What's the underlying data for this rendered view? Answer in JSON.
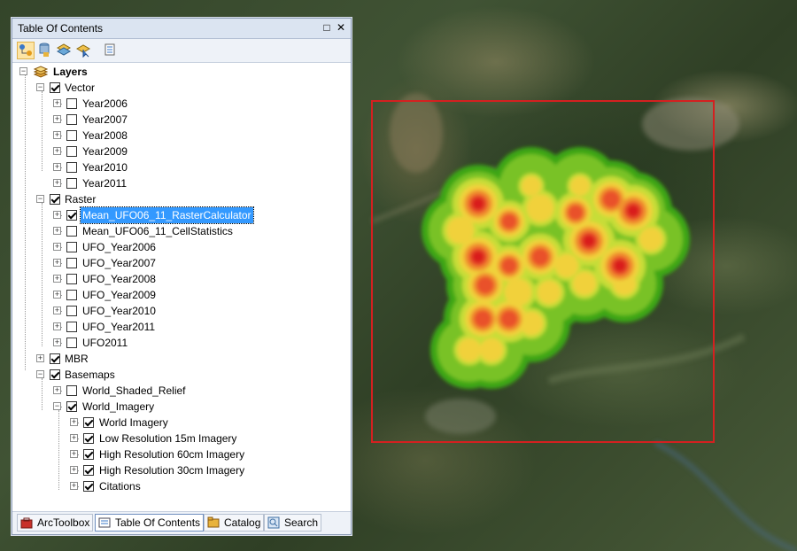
{
  "panel": {
    "title": "Table Of Contents",
    "controls": {
      "pin": "□",
      "close": "✕"
    }
  },
  "toolbar": {
    "buttons": [
      "list-by-drawing-order-icon",
      "list-by-source-icon",
      "list-by-visibility-icon",
      "list-by-selection-icon",
      "options-icon"
    ]
  },
  "tree": {
    "root": "Layers",
    "groups": {
      "vector": {
        "label": "Vector",
        "checked": true,
        "items": [
          {
            "label": "Year2006",
            "checked": false
          },
          {
            "label": "Year2007",
            "checked": false
          },
          {
            "label": "Year2008",
            "checked": false
          },
          {
            "label": "Year2009",
            "checked": false
          },
          {
            "label": "Year2010",
            "checked": false
          },
          {
            "label": "Year2011",
            "checked": false
          }
        ]
      },
      "raster": {
        "label": "Raster",
        "checked": true,
        "items": [
          {
            "label": "Mean_UFO06_11_RasterCalculator",
            "checked": true,
            "selected": true
          },
          {
            "label": "Mean_UFO06_11_CellStatistics",
            "checked": false
          },
          {
            "label": "UFO_Year2006",
            "checked": false
          },
          {
            "label": "UFO_Year2007",
            "checked": false
          },
          {
            "label": "UFO_Year2008",
            "checked": false
          },
          {
            "label": "UFO_Year2009",
            "checked": false
          },
          {
            "label": "UFO_Year2010",
            "checked": false
          },
          {
            "label": "UFO_Year2011",
            "checked": false
          },
          {
            "label": "UFO2011",
            "checked": false
          }
        ]
      },
      "mbr": {
        "label": "MBR",
        "checked": true
      },
      "basemaps": {
        "label": "Basemaps",
        "checked": true,
        "items": [
          {
            "label": "World_Shaded_Relief",
            "checked": false
          },
          {
            "label": "World_Imagery",
            "checked": true
          }
        ],
        "imagery_items": [
          {
            "label": "World Imagery",
            "checked": true
          },
          {
            "label": "Low Resolution 15m Imagery",
            "checked": true
          },
          {
            "label": "High Resolution 60cm Imagery",
            "checked": true
          },
          {
            "label": "High Resolution 30cm Imagery",
            "checked": true
          },
          {
            "label": "Citations",
            "checked": true
          }
        ]
      }
    }
  },
  "tabs": [
    {
      "label": "ArcToolbox",
      "icon": "toolbox-icon"
    },
    {
      "label": "Table Of Contents",
      "icon": "toc-icon",
      "active": true
    },
    {
      "label": "Catalog",
      "icon": "catalog-icon"
    },
    {
      "label": "Search",
      "icon": "search-icon"
    }
  ],
  "map": {
    "mbr_color": "#d42020",
    "heat_colors": [
      "#3ea618",
      "#79c226",
      "#c7dd37",
      "#f1d13b",
      "#f0922f",
      "#e9512a",
      "#d91e1e"
    ]
  }
}
